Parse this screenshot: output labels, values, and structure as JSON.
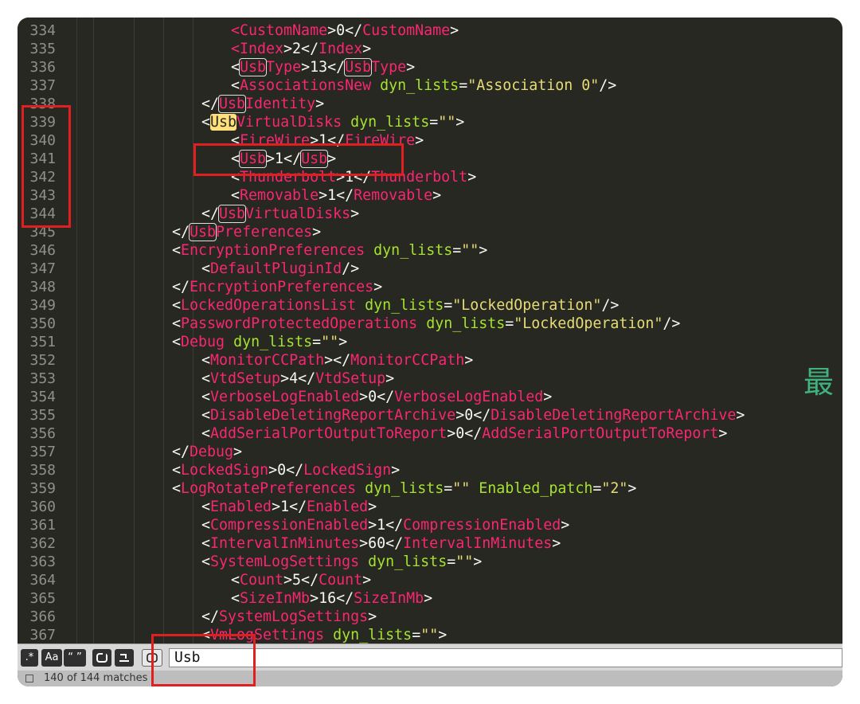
{
  "editor": {
    "line_numbers": [
      "334",
      "335",
      "336",
      "337",
      "338",
      "339",
      "340",
      "341",
      "342",
      "343",
      "344",
      "345",
      "346",
      "347",
      "348",
      "349",
      "350",
      "351",
      "352",
      "353",
      "354",
      "355",
      "356",
      "357",
      "358",
      "359",
      "360",
      "361",
      "362",
      "363",
      "364",
      "365",
      "366",
      "367"
    ],
    "lines": [
      [
        [
          "t",
          "<"
        ],
        [
          "t",
          "CustomName"
        ],
        [
          "p",
          ">0</"
        ],
        [
          "t",
          "CustomName"
        ],
        [
          "p",
          ">"
        ]
      ],
      [
        [
          "t",
          "<"
        ],
        [
          "t",
          "Index"
        ],
        [
          "p",
          ">2</"
        ],
        [
          "t",
          "Index"
        ],
        [
          "p",
          ">"
        ]
      ],
      [
        [
          "p",
          "<"
        ],
        [
          "tm",
          "Usb"
        ],
        [
          "t",
          "Type"
        ],
        [
          "p",
          ">13</"
        ],
        [
          "tm",
          "Usb"
        ],
        [
          "t",
          "Type"
        ],
        [
          "p",
          ">"
        ]
      ],
      [
        [
          "p",
          "<"
        ],
        [
          "t",
          "AssociationsNew"
        ],
        [
          "p",
          " "
        ],
        [
          "a",
          "dyn_lists"
        ],
        [
          "p",
          "="
        ],
        [
          "s",
          "\"Association 0\""
        ],
        [
          "p",
          "/>"
        ]
      ],
      [
        [
          "p",
          "</"
        ],
        [
          "tm",
          "Usb"
        ],
        [
          "t",
          "Identity"
        ],
        [
          "p",
          ">"
        ]
      ],
      [
        [
          "p",
          "<"
        ],
        [
          "cur",
          "Usb"
        ],
        [
          "t",
          "VirtualDisks"
        ],
        [
          "p",
          " "
        ],
        [
          "a",
          "dyn_lists"
        ],
        [
          "p",
          "="
        ],
        [
          "s",
          "\"\""
        ],
        [
          "p",
          ">"
        ]
      ],
      [
        [
          "p",
          "<"
        ],
        [
          "t",
          "FireWire"
        ],
        [
          "p",
          ">1</"
        ],
        [
          "t",
          "FireWire"
        ],
        [
          "p",
          ">"
        ]
      ],
      [
        [
          "p",
          "<"
        ],
        [
          "tm",
          "Usb"
        ],
        [
          "p",
          ">1</"
        ],
        [
          "tm",
          "Usb"
        ],
        [
          "p",
          ">"
        ]
      ],
      [
        [
          "p",
          "<"
        ],
        [
          "t",
          "Thunderbolt"
        ],
        [
          "p",
          ">1</"
        ],
        [
          "t",
          "Thunderbolt"
        ],
        [
          "p",
          ">"
        ]
      ],
      [
        [
          "p",
          "<"
        ],
        [
          "t",
          "Removable"
        ],
        [
          "p",
          ">1</"
        ],
        [
          "t",
          "Removable"
        ],
        [
          "p",
          ">"
        ]
      ],
      [
        [
          "p",
          "</"
        ],
        [
          "tm",
          "Usb"
        ],
        [
          "t",
          "VirtualDisks"
        ],
        [
          "p",
          ">"
        ]
      ],
      [
        [
          "p",
          "</"
        ],
        [
          "tm",
          "Usb"
        ],
        [
          "t",
          "Preferences"
        ],
        [
          "p",
          ">"
        ]
      ],
      [
        [
          "p",
          "<"
        ],
        [
          "t",
          "EncryptionPreferences"
        ],
        [
          "p",
          " "
        ],
        [
          "a",
          "dyn_lists"
        ],
        [
          "p",
          "="
        ],
        [
          "s",
          "\"\""
        ],
        [
          "p",
          ">"
        ]
      ],
      [
        [
          "p",
          "<"
        ],
        [
          "t",
          "DefaultPluginId"
        ],
        [
          "p",
          "/>"
        ]
      ],
      [
        [
          "p",
          "</"
        ],
        [
          "t",
          "EncryptionPreferences"
        ],
        [
          "p",
          ">"
        ]
      ],
      [
        [
          "p",
          "<"
        ],
        [
          "t",
          "LockedOperationsList"
        ],
        [
          "p",
          " "
        ],
        [
          "a",
          "dyn_lists"
        ],
        [
          "p",
          "="
        ],
        [
          "s",
          "\"LockedOperation\""
        ],
        [
          "p",
          "/>"
        ]
      ],
      [
        [
          "p",
          "<"
        ],
        [
          "t",
          "PasswordProtectedOperations"
        ],
        [
          "p",
          " "
        ],
        [
          "a",
          "dyn_lists"
        ],
        [
          "p",
          "="
        ],
        [
          "s",
          "\"LockedOperation\""
        ],
        [
          "p",
          "/>"
        ]
      ],
      [
        [
          "p",
          "<"
        ],
        [
          "t",
          "Debug"
        ],
        [
          "p",
          " "
        ],
        [
          "a",
          "dyn_lists"
        ],
        [
          "p",
          "="
        ],
        [
          "s",
          "\"\""
        ],
        [
          "p",
          ">"
        ]
      ],
      [
        [
          "p",
          "<"
        ],
        [
          "t",
          "MonitorCCPath"
        ],
        [
          "p",
          "></"
        ],
        [
          "t",
          "MonitorCCPath"
        ],
        [
          "p",
          ">"
        ]
      ],
      [
        [
          "p",
          "<"
        ],
        [
          "t",
          "VtdSetup"
        ],
        [
          "p",
          ">4</"
        ],
        [
          "t",
          "VtdSetup"
        ],
        [
          "p",
          ">"
        ]
      ],
      [
        [
          "p",
          "<"
        ],
        [
          "t",
          "VerboseLogEnabled"
        ],
        [
          "p",
          ">0</"
        ],
        [
          "t",
          "VerboseLogEnabled"
        ],
        [
          "p",
          ">"
        ]
      ],
      [
        [
          "p",
          "<"
        ],
        [
          "t",
          "DisableDeletingReportArchive"
        ],
        [
          "p",
          ">0</"
        ],
        [
          "t",
          "DisableDeletingReportArchive"
        ],
        [
          "p",
          ">"
        ]
      ],
      [
        [
          "p",
          "<"
        ],
        [
          "t",
          "AddSerialPortOutputToReport"
        ],
        [
          "p",
          ">0</"
        ],
        [
          "t",
          "AddSerialPortOutputToReport"
        ],
        [
          "p",
          ">"
        ]
      ],
      [
        [
          "p",
          "</"
        ],
        [
          "t",
          "Debug"
        ],
        [
          "p",
          ">"
        ]
      ],
      [
        [
          "p",
          "<"
        ],
        [
          "t",
          "LockedSign"
        ],
        [
          "p",
          ">0</"
        ],
        [
          "t",
          "LockedSign"
        ],
        [
          "p",
          ">"
        ]
      ],
      [
        [
          "p",
          "<"
        ],
        [
          "t",
          "LogRotatePreferences"
        ],
        [
          "p",
          " "
        ],
        [
          "a",
          "dyn_lists"
        ],
        [
          "p",
          "="
        ],
        [
          "s",
          "\"\""
        ],
        [
          "p",
          " "
        ],
        [
          "a",
          "Enabled_patch"
        ],
        [
          "p",
          "="
        ],
        [
          "s",
          "\"2\""
        ],
        [
          "p",
          ">"
        ]
      ],
      [
        [
          "p",
          "<"
        ],
        [
          "t",
          "Enabled"
        ],
        [
          "p",
          ">1</"
        ],
        [
          "t",
          "Enabled"
        ],
        [
          "p",
          ">"
        ]
      ],
      [
        [
          "p",
          "<"
        ],
        [
          "t",
          "CompressionEnabled"
        ],
        [
          "p",
          ">1</"
        ],
        [
          "t",
          "CompressionEnabled"
        ],
        [
          "p",
          ">"
        ]
      ],
      [
        [
          "p",
          "<"
        ],
        [
          "t",
          "IntervalInMinutes"
        ],
        [
          "p",
          ">60</"
        ],
        [
          "t",
          "IntervalInMinutes"
        ],
        [
          "p",
          ">"
        ]
      ],
      [
        [
          "p",
          "<"
        ],
        [
          "t",
          "SystemLogSettings"
        ],
        [
          "p",
          " "
        ],
        [
          "a",
          "dyn_lists"
        ],
        [
          "p",
          "="
        ],
        [
          "s",
          "\"\""
        ],
        [
          "p",
          ">"
        ]
      ],
      [
        [
          "p",
          "<"
        ],
        [
          "t",
          "Count"
        ],
        [
          "p",
          ">5</"
        ],
        [
          "t",
          "Count"
        ],
        [
          "p",
          ">"
        ]
      ],
      [
        [
          "p",
          "<"
        ],
        [
          "t",
          "SizeInMb"
        ],
        [
          "p",
          ">16</"
        ],
        [
          "t",
          "SizeInMb"
        ],
        [
          "p",
          ">"
        ]
      ],
      [
        [
          "p",
          "</"
        ],
        [
          "t",
          "SystemLogSettings"
        ],
        [
          "p",
          ">"
        ]
      ],
      [
        [
          "p",
          "<"
        ],
        [
          "t",
          "VmLogSettings"
        ],
        [
          "p",
          " "
        ],
        [
          "a",
          "dyn_lists"
        ],
        [
          "p",
          "="
        ],
        [
          "s",
          "\"\""
        ],
        [
          "p",
          ">"
        ]
      ]
    ],
    "colors": {
      "background": "#272822",
      "tag": "#f92672",
      "attribute": "#a6e22e",
      "string": "#e6db74",
      "punct": "#f8f8f2",
      "current_match": "#ffe07a",
      "annotation": "#e02020"
    }
  },
  "find_bar": {
    "regex_label": ".*",
    "case_label": "Aa",
    "word_label": "“ ”",
    "wrap_icon": "wrap-icon",
    "in_selection_icon": "in-selection-icon",
    "highlight_icon": "highlight-matches-icon",
    "search_value": "Usb"
  },
  "status": {
    "text": "140 of 144 matches"
  },
  "overlay_text": "最"
}
